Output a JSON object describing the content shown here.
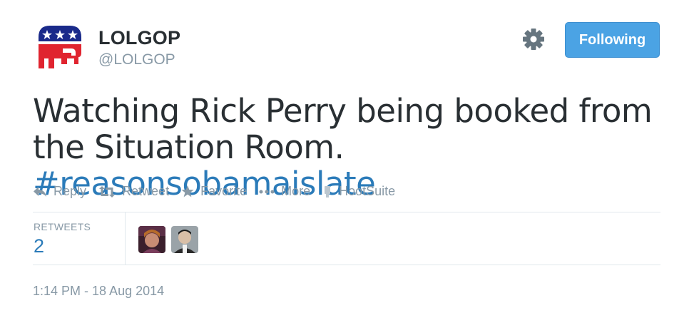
{
  "author": {
    "name": "LOLGOP",
    "handle": "@LOLGOP",
    "avatar_icon": "gop-elephant-logo"
  },
  "header": {
    "settings_icon": "gear-icon",
    "follow_button_label": "Following"
  },
  "tweet": {
    "text": "Watching Rick Perry being booked from the Situation Room.",
    "hashtag": "#reasonsobamaislate"
  },
  "actions": [
    {
      "label": "Reply",
      "icon": "reply-icon"
    },
    {
      "label": "Retweet",
      "icon": "retweet-icon"
    },
    {
      "label": "Favorite",
      "icon": "star-icon"
    },
    {
      "label": "More",
      "icon": "ellipsis-icon"
    },
    {
      "label": "HootSuite",
      "icon": "hootsuite-icon"
    }
  ],
  "stats": {
    "retweets_label": "RETWEETS",
    "retweets_count": "2",
    "retweeter_avatars": [
      "retweeter-avatar-1",
      "retweeter-avatar-2"
    ]
  },
  "timestamp": "1:14 PM - 18 Aug 2014",
  "colors": {
    "link": "#2b7bb9",
    "follow_button": "#4ba3e4",
    "muted": "#8899a6",
    "text": "#292f33",
    "logo_red": "#e0242f",
    "logo_blue": "#1a2a8a"
  }
}
